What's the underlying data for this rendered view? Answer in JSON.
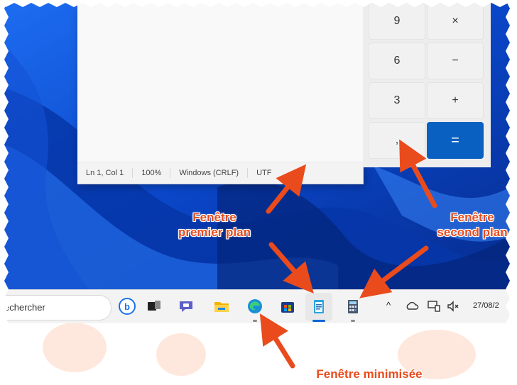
{
  "notepad": {
    "status": {
      "position": "Ln 1, Col 1",
      "zoom": "100%",
      "line_ending": "Windows (CRLF)",
      "encoding": "UTF"
    }
  },
  "calculator": {
    "keys": [
      "9",
      "×",
      "6",
      "−",
      "3",
      "+",
      ",",
      "="
    ]
  },
  "taskbar": {
    "search_text": "echercher",
    "icons": [
      "bing-icon",
      "task-view-icon",
      "chat-icon",
      "file-explorer-icon",
      "edge-icon",
      "store-icon",
      "notepad-icon",
      "calculator-icon"
    ],
    "tray": {
      "chevron": "^",
      "clock": "27/08/2"
    }
  },
  "annotations": {
    "foreground_line1": "Fenêtre",
    "foreground_line2": "premier plan",
    "background_line1": "Fenêtre",
    "background_line2": "second plan",
    "minimized": "Fenêtre minimisée"
  },
  "colors": {
    "accent": "#e94b1d",
    "equal_key": "#0a60c0",
    "wallpaper": "#0b3fa6"
  }
}
